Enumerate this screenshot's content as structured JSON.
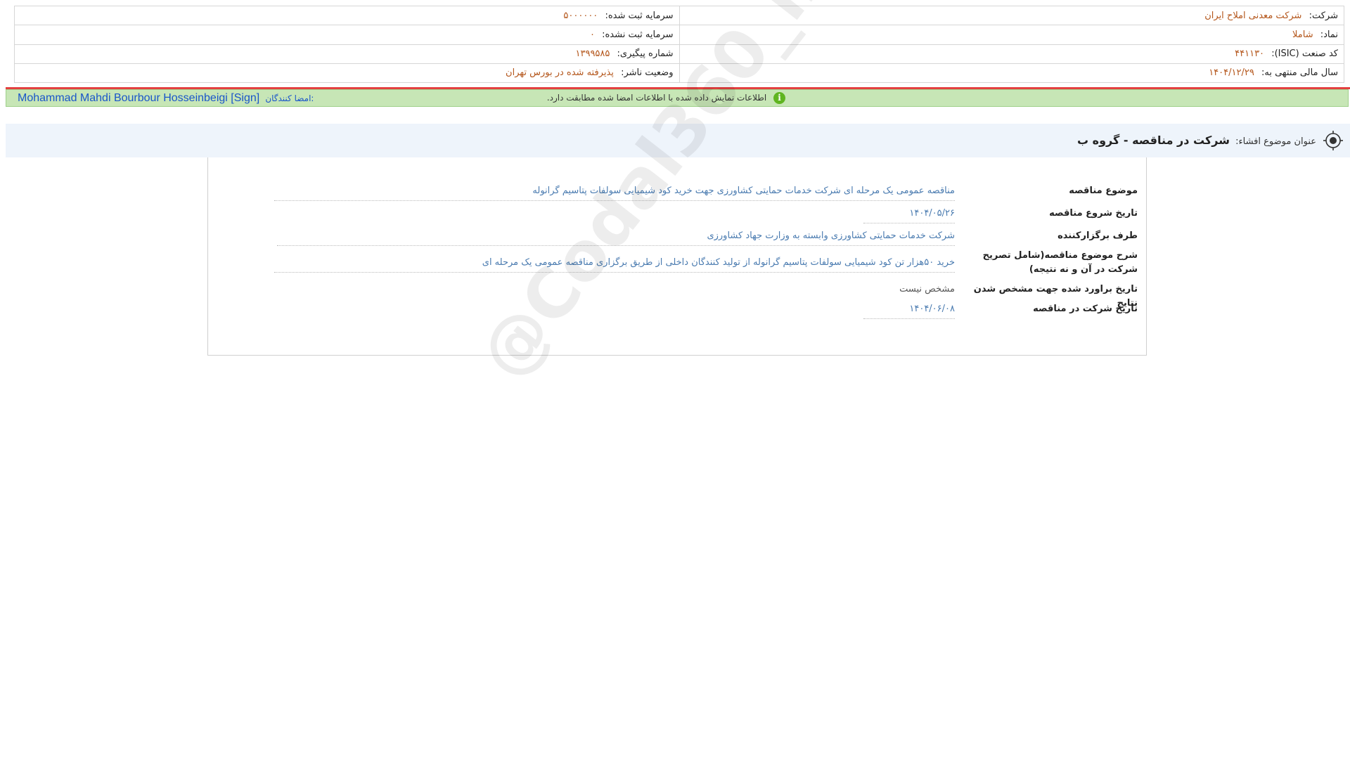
{
  "company_info": {
    "company_label": "شرکت:",
    "company_value": "شرکت معدنی املاح ایران",
    "registered_capital_label": "سرمایه ثبت شده:",
    "registered_capital_value": "۵۰۰۰۰۰۰",
    "symbol_label": "نماد:",
    "symbol_value": "شاملا",
    "unregistered_capital_label": "سرمایه ثبت نشده:",
    "unregistered_capital_value": "۰",
    "isic_label": "کد صنعت (ISIC):",
    "isic_value": "۴۴۱۱۳۰",
    "tracking_label": "شماره پیگیری:",
    "tracking_value": "۱۳۹۹۵۸۵",
    "fiscal_year_label": "سال مالی منتهی به:",
    "fiscal_year_value": "۱۴۰۴/۱۲/۲۹",
    "publisher_status_label": "وضعیت ناشر:",
    "publisher_status_value": "پذیرفته شده در بورس تهران"
  },
  "signature": {
    "verify_text": "اطلاعات نمایش داده شده با اطلاعات امضا شده مطابقت دارد.",
    "verify_icon": "info-icon",
    "signers_label": "امضا کنندگان:",
    "signer_name": "Mohammad Mahdi Bourbour Hosseinbeigi [Sign]"
  },
  "subject": {
    "label": "عنوان موضوع افشاء:",
    "value": "شرکت در مناقصه - گروه ب",
    "icon": "target-icon"
  },
  "tender": {
    "rows": [
      {
        "key": "موضوع مناقصه",
        "value": "مناقصه عمومی یک مرحله ای شرکت خدمات حمایتی کشاورزی جهت خرید کود شیمیایی سولفات پتاسیم گرانوله"
      },
      {
        "key": "تاریخ شروع مناقصه",
        "value": "۱۴۰۴/۰۵/۲۶"
      },
      {
        "key": "طرف برگزارکننده",
        "value": "شرکت خدمات حمایتی کشاورزی وابسته به وزارت جهاد کشاورزی"
      },
      {
        "key": "شرح موضوع مناقصه(شامل تصریح شرکت در آن و نه نتیجه)",
        "value": "خرید ۵۰هزار تن کود شیمیایی سولفات پتاسیم گرانوله از تولید کنندگان داخلی از طریق برگزاری مناقصه عمومی یک مرحله ای"
      },
      {
        "key": "تاریخ براورد شده جهت مشخص شدن نتایج",
        "value": "مشخص نیست"
      },
      {
        "key": "تاریخ شرکت در مناقصه",
        "value": "۱۴۰۴/۰۶/۰۸"
      }
    ]
  },
  "watermark": "@Codal360_ir"
}
